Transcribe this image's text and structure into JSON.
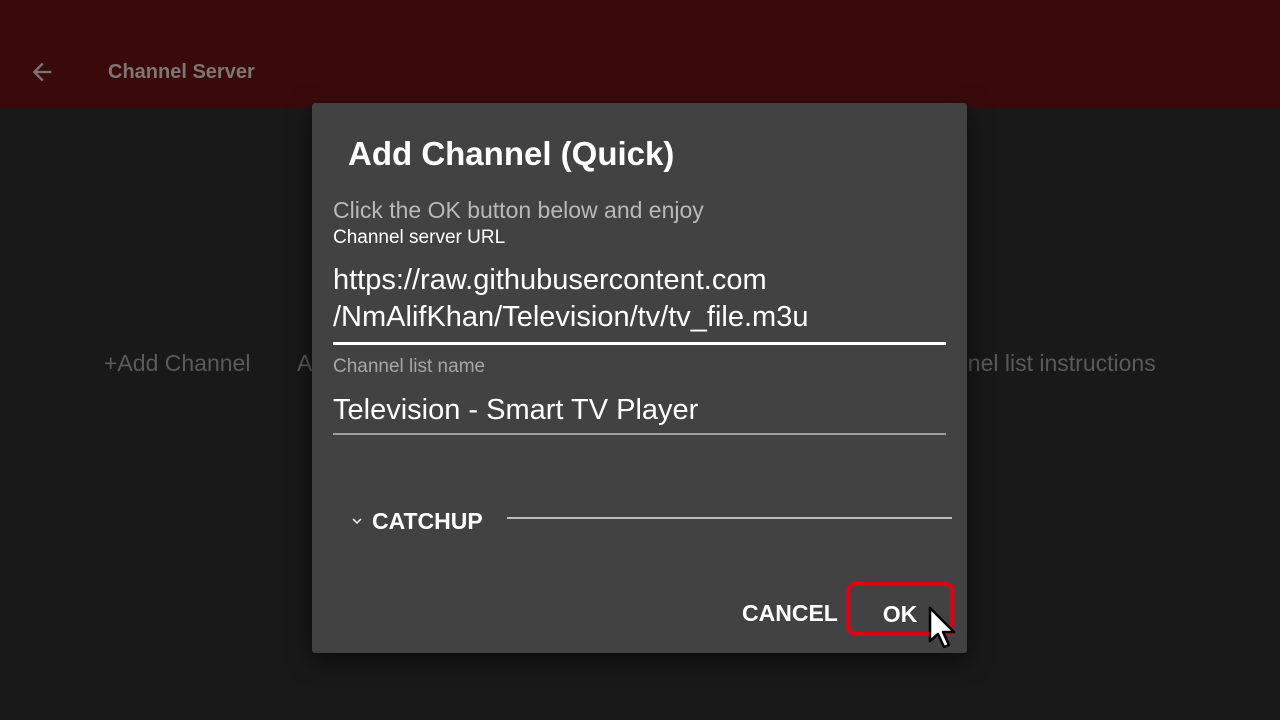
{
  "appbar": {
    "title": "Channel Server",
    "back_icon": "arrow-left-icon"
  },
  "background": {
    "add_channel_label": "+Add Channel",
    "partial_label": "A",
    "instructions_label": "nnel list instructions"
  },
  "dialog": {
    "title": "Add Channel (Quick)",
    "message": "Click the OK button below and enjoy",
    "url_label": "Channel server URL",
    "url_value_line1": "https://raw.githubusercontent.com",
    "url_value_line2": "/NmAlifKhan/Television/tv/tv_file.m3u",
    "name_label": "Channel list name",
    "name_value": "Television - Smart TV Player",
    "catchup_label": "CATCHUP",
    "catchup_icon": "chevron-down-icon",
    "cancel_label": "CANCEL",
    "ok_label": "OK"
  },
  "colors": {
    "appbar_bg": "#3a0a0b",
    "dialog_bg": "#424242",
    "focus_outline": "#e1000f"
  }
}
